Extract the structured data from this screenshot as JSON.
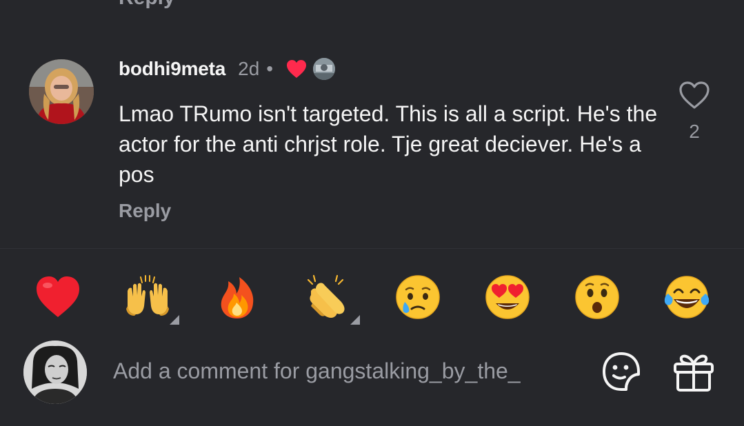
{
  "colors": {
    "background": "#26272b",
    "text_primary": "#f5f5f5",
    "text_secondary": "#9a9ca3",
    "like_red": "#ff2a4d"
  },
  "previous_comment": {
    "reply_label_fragment": "Reply"
  },
  "comment": {
    "username": "bodhi9meta",
    "time": "2d",
    "separator": "•",
    "creator_liked_icon": "red-heart-icon",
    "creator_avatar_icon": "creator-avatar",
    "text": "Lmao TRumo isn't targeted. This is all a script. He's the actor for the anti chrjst role. Tje great deciever. He's a pos",
    "reply_label": "Reply",
    "like_icon": "heart-outline-icon",
    "like_count": "2"
  },
  "emoji_bar": {
    "emojis": [
      {
        "name": "red-heart",
        "symbol": "❤️"
      },
      {
        "name": "raising-hands",
        "symbol": "🙌"
      },
      {
        "name": "fire",
        "symbol": "🔥"
      },
      {
        "name": "clapping-hands",
        "symbol": "👏"
      },
      {
        "name": "crying-face",
        "symbol": "😢"
      },
      {
        "name": "heart-eyes",
        "symbol": "😍"
      },
      {
        "name": "surprised-face",
        "symbol": "😮"
      },
      {
        "name": "tears-of-joy",
        "symbol": "😂"
      }
    ]
  },
  "composer": {
    "placeholder": "Add a comment for gangstalking_by_the_",
    "sticker_icon": "sticker-icon",
    "gift_icon": "gift-icon"
  }
}
